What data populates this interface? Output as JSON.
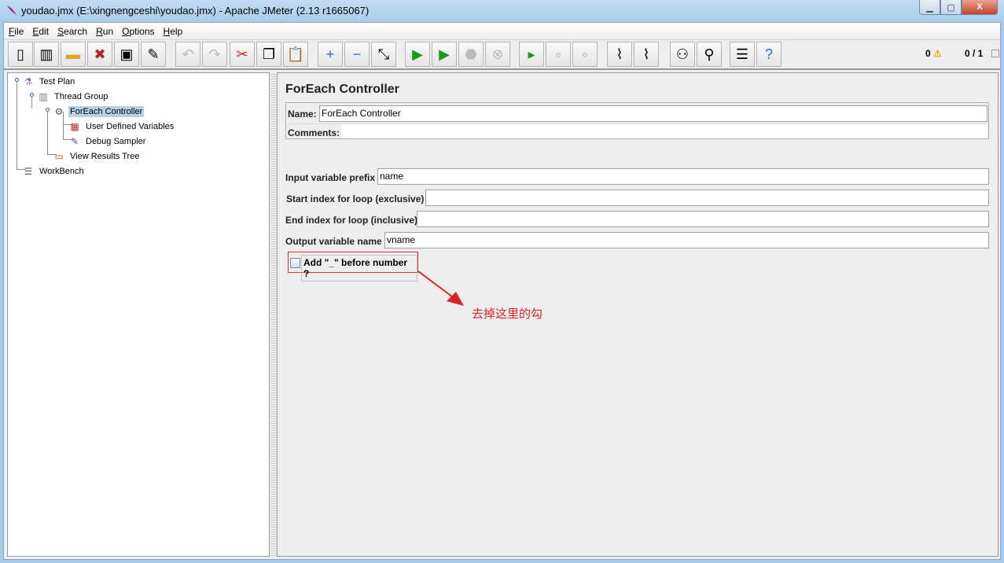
{
  "window": {
    "title": "youdao.jmx (E:\\xingnengceshi\\youdao.jmx) - Apache JMeter (2.13 r1665067)",
    "min": "▁",
    "max": "▢",
    "close": "X"
  },
  "menu": [
    {
      "key": "F",
      "rest": "ile"
    },
    {
      "key": "E",
      "rest": "dit"
    },
    {
      "key": "S",
      "rest": "earch"
    },
    {
      "key": "R",
      "rest": "un"
    },
    {
      "key": "O",
      "rest": "ptions"
    },
    {
      "key": "H",
      "rest": "elp"
    }
  ],
  "toolbar": {
    "buttons": [
      {
        "name": "new",
        "glyph": "▯"
      },
      {
        "name": "templates",
        "glyph": "▥"
      },
      {
        "name": "open",
        "glyph": "▬"
      },
      {
        "name": "close",
        "glyph": "✖"
      },
      {
        "name": "save",
        "glyph": "▣"
      },
      {
        "name": "save-screenshot",
        "glyph": "✎"
      },
      {
        "name": "undo",
        "glyph": "↶"
      },
      {
        "name": "redo",
        "glyph": "↷"
      },
      {
        "name": "cut",
        "glyph": "✂"
      },
      {
        "name": "copy",
        "glyph": "❐"
      },
      {
        "name": "paste",
        "glyph": "📋"
      },
      {
        "name": "expand",
        "glyph": "+"
      },
      {
        "name": "collapse",
        "glyph": "−"
      },
      {
        "name": "toggle",
        "glyph": "⤡"
      },
      {
        "name": "start",
        "glyph": "▶"
      },
      {
        "name": "start-no-pauses",
        "glyph": "▶"
      },
      {
        "name": "stop",
        "glyph": "⬣"
      },
      {
        "name": "shutdown",
        "glyph": "⊗"
      },
      {
        "name": "remote-start",
        "glyph": "▸"
      },
      {
        "name": "remote-stop",
        "glyph": "∘"
      },
      {
        "name": "remote-shutdown",
        "glyph": "∘"
      },
      {
        "name": "clear",
        "glyph": "⌇"
      },
      {
        "name": "clear-all",
        "glyph": "⌇"
      },
      {
        "name": "search",
        "glyph": "⚇"
      },
      {
        "name": "reset-search",
        "glyph": "⚲"
      },
      {
        "name": "function-helper",
        "glyph": "☰"
      },
      {
        "name": "help",
        "glyph": "?"
      }
    ],
    "warnings": "0",
    "threads": "0 / 1"
  },
  "tree": [
    {
      "label": "Test Plan",
      "icon": "flask"
    },
    {
      "label": "Thread Group",
      "icon": "spool"
    },
    {
      "label": "ForEach Controller",
      "icon": "gear"
    },
    {
      "label": "User Defined Variables",
      "icon": "variables"
    },
    {
      "label": "Debug Sampler",
      "icon": "pipette"
    },
    {
      "label": "View Results Tree",
      "icon": "chart"
    },
    {
      "label": "WorkBench",
      "icon": "clipboard"
    }
  ],
  "panel": {
    "title": "ForEach Controller",
    "name_label": "Name:",
    "name_value": "ForEach Controller",
    "comments_label": "Comments:",
    "input_prefix_label": "Input variable prefix",
    "input_prefix_value": "name",
    "start_label": "Start index for loop (exclusive)",
    "start_value": "",
    "end_label": "End index for loop (inclusive)",
    "end_value": "",
    "output_label": "Output variable name",
    "output_value": "vname",
    "checkbox_label": "Add \"_\" before number ?",
    "checkbox_checked": false
  },
  "annotation": "去掉这里的勾",
  "colors": {
    "annotation": "#e02020",
    "selection": "#b8cfe5"
  }
}
